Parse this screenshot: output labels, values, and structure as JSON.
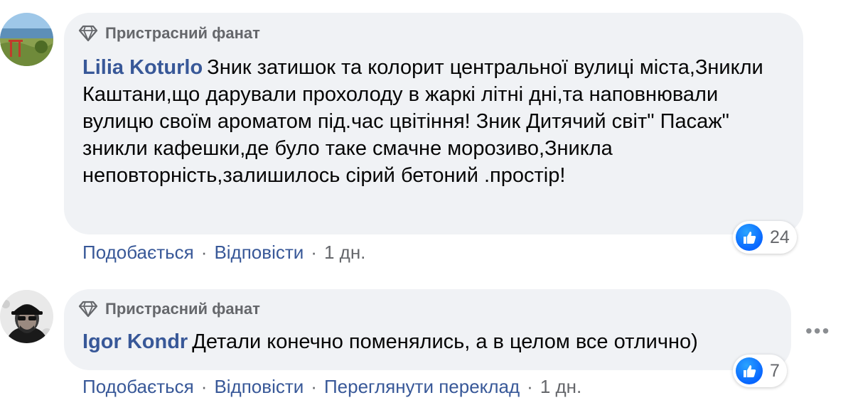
{
  "comments": [
    {
      "badge": "Пристрасний фанат",
      "author": "Lilia Koturlo",
      "text": "Зник затишок та колорит центральної вулиці міста,Зникли Каштани,що дарували прохолоду в жаркі літні дні,та наповнювали вулицю своїм ароматом під.час цвітіння! Зник Дитячий світ\" Пасаж\" зникли кафешки,де було таке смачне морозиво,Зникла неповторність,залишилось сірий бетоний .простір!",
      "actions": {
        "like": "Подобається",
        "reply": "Відповісти",
        "time": "1 дн."
      },
      "reaction_count": "24"
    },
    {
      "badge": "Пристрасний фанат",
      "author": "Igor Kondr",
      "text": "Детали конечно поменялись, а в целом все отлично)",
      "actions": {
        "like": "Подобається",
        "reply": "Відповісти",
        "translate": "Переглянути переклад",
        "time": "1 дн."
      },
      "reaction_count": "7"
    }
  ],
  "separator": "·",
  "icons": {
    "badge": "diamond-icon",
    "reaction": "like-icon",
    "more": "more-options-icon"
  },
  "colors": {
    "link": "#385898",
    "bubble": "#f0f2f5",
    "meta": "#65676b",
    "like": "#0866ff"
  }
}
